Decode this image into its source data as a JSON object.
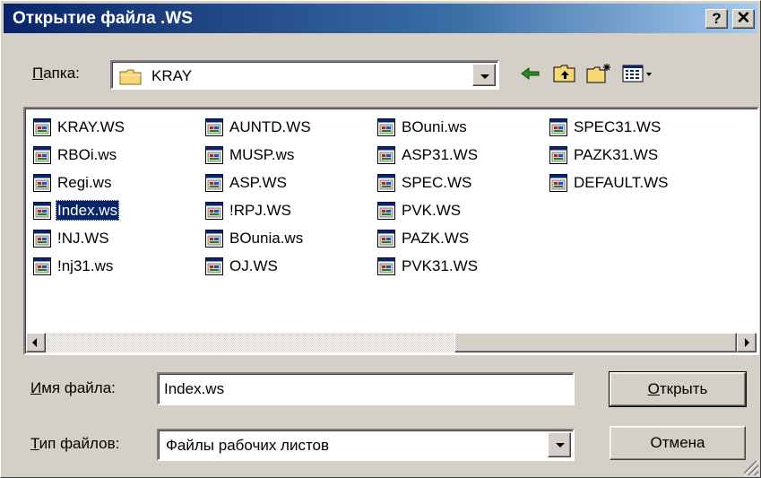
{
  "window": {
    "title": "Открытие файла .WS",
    "help_label": "?",
    "close_label": "✕"
  },
  "folder": {
    "label_first": "П",
    "label_rest": "апка:",
    "value": "KRAY"
  },
  "toolbar": {
    "icons": [
      "back-arrow-icon",
      "up-folder-icon",
      "new-folder-icon",
      "view-menu-icon"
    ]
  },
  "files": {
    "columns": [
      [
        "KRAY.WS",
        "RBOi.ws",
        "Regi.ws",
        "Index.ws",
        "!NJ.WS",
        "!nj31.ws"
      ],
      [
        "AUNTD.WS",
        "MUSP.ws",
        "ASP.WS",
        "!RPJ.WS",
        "BOunia.ws",
        "OJ.WS"
      ],
      [
        "BOuni.ws",
        "ASP31.WS",
        "SPEC.WS",
        "PVK.WS",
        "PAZK.WS",
        "PVK31.WS"
      ],
      [
        "SPEC31.WS",
        "PAZK31.WS",
        "DEFAULT.WS"
      ]
    ],
    "selected": "Index.ws"
  },
  "filename": {
    "label_first": "И",
    "label_rest": "мя файла:",
    "value": "Index.ws"
  },
  "filetype": {
    "label_first": "Т",
    "label_rest": "ип файлов:",
    "value": "Файлы рабочих листов"
  },
  "buttons": {
    "open_first": "О",
    "open_rest": "ткрыть",
    "cancel": "Отмена"
  },
  "colors": {
    "title_bar": "#0a246a",
    "face": "#d4d0c8",
    "selection": "#0a246a"
  }
}
